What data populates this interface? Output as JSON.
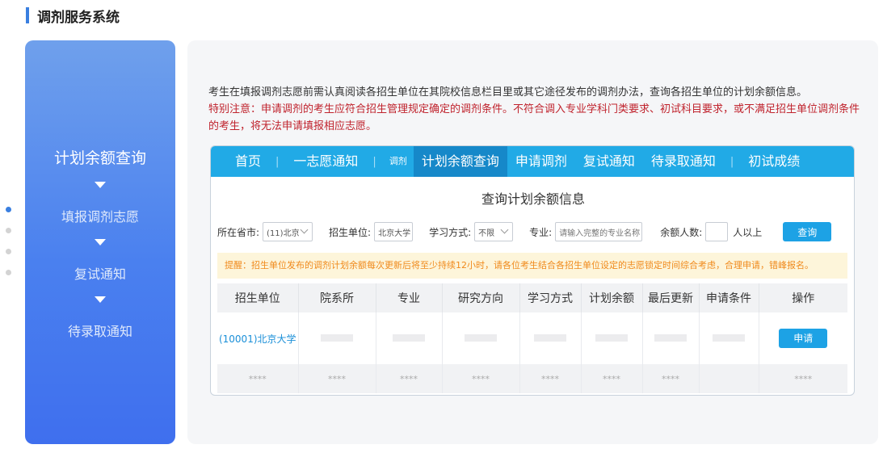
{
  "header": {
    "title": "调剂服务系统"
  },
  "sidebar": {
    "steps": [
      {
        "label": "计划余额查询",
        "active": true
      },
      {
        "label": "填报调剂志愿",
        "active": false
      },
      {
        "label": "复试通知",
        "active": false
      },
      {
        "label": "待录取通知",
        "active": false
      }
    ]
  },
  "intro": {
    "line": "考生在填报调剂志愿前需认真阅读各招生单位在其院校信息栏目里或其它途径发布的调剂办法，查询各招生单位的计划余额信息。",
    "notice": "特别注意：申请调剂的考生应符合招生管理规定确定的调剂条件。不符合调入专业学科门类要求、初试科目要求，或不满足招生单位调剂条件的考生，将无法申请填报相应志愿。"
  },
  "nav": {
    "items": [
      "首页",
      "一志愿通知",
      "调剂",
      "计划余额查询",
      "申请调剂",
      "复试通知",
      "待录取通知",
      "初试成绩"
    ],
    "separator": "|"
  },
  "query": {
    "title": "查询计划余额信息",
    "province_label": "所在省市:",
    "province_value": "(11)北京",
    "unit_label": "招生单位:",
    "unit_value": "北京大学",
    "mode_label": "学习方式:",
    "mode_value": "不限",
    "major_label": "专业:",
    "major_placeholder": "请输入完整的专业名称",
    "count_label": "余额人数:",
    "count_suffix": "人以上",
    "button": "查询"
  },
  "tip": "提醒：招生单位发布的调剂计划余额每次更新后将至少持续12小时，请各位考生结合各招生单位设定的志愿锁定时间综合考虑，合理申请，错峰报名。",
  "table": {
    "headers": [
      "招生单位",
      "院系所",
      "专业",
      "研究方向",
      "学习方式",
      "计划余额",
      "最后更新",
      "申请条件",
      "操作"
    ],
    "row1_unit": "(10001)北京大学",
    "apply_label": "申请",
    "mask": "****"
  },
  "colors": {
    "accent": "#21aae6",
    "sidebar": "#4a80ef",
    "notice": "#c0232d",
    "tip": "#f08a1c"
  }
}
